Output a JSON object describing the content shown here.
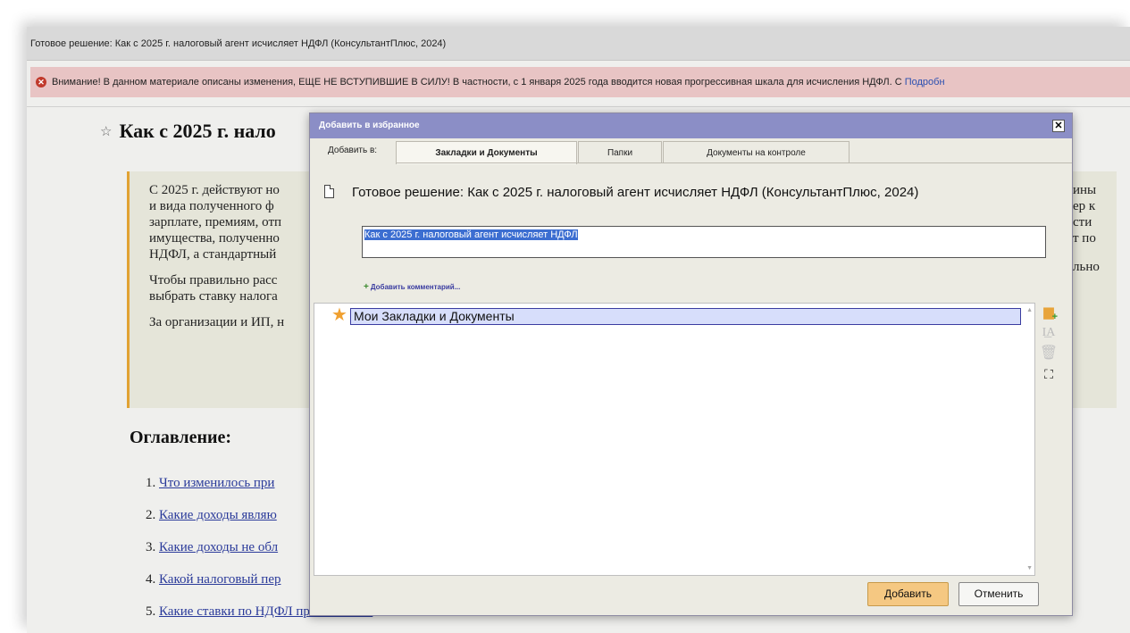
{
  "document": {
    "window_title": "Готовое решение: Как с 2025 г. налоговый агент исчисляет НДФЛ (КонсультантПлюс, 2024)",
    "warning_text": "Внимание! В данном материале описаны изменения, ЕЩЕ НЕ ВСТУПИВШИЕ В СИЛУ! В частности, с 1 января 2025 года вводится новая прогрессивная шкала для исчисления НДФЛ. С",
    "warning_more": "Подробн",
    "heading": "Как с 2025 г. нало",
    "infobox": {
      "left_lines": [
        "С 2025 г. действуют но",
        "и вида полученного ф",
        "зарплате, премиям, отп",
        "имущества, полученно",
        "НДФЛ, а стандартный"
      ],
      "left_para2": [
        "Чтобы правильно расс",
        "выбрать ставку налога"
      ],
      "left_para3": "За организации и ИП, н",
      "right_lines": [
        "ины",
        "ер к",
        "сти",
        "т по"
      ],
      "right_para2": "льно"
    },
    "toc_heading": "Оглавление:",
    "toc": [
      {
        "num": "1.",
        "text": "Что изменилось при"
      },
      {
        "num": "2.",
        "text": "Какие доходы являю"
      },
      {
        "num": "3.",
        "text": "Какие доходы не обл"
      },
      {
        "num": "4.",
        "text": "Какой налоговый пер"
      },
      {
        "num": "5.",
        "text": "Какие ставки по НДФЛ применяются"
      }
    ]
  },
  "dialog": {
    "title": "Добавить в избранное",
    "close_glyph": "✕",
    "add_to_label": "Добавить в:",
    "tabs": [
      "Закладки и Документы",
      "Папки",
      "Документы на контроле"
    ],
    "doc_line": "Готовое решение: Как с 2025 г. налоговый агент исчисляет НДФЛ (КонсультантПлюс, 2024)",
    "name_value": "Как с 2025 г. налоговый агент исчисляет НДФЛ",
    "add_comment": "Добавить комментарий...",
    "tree_item": "Мои Закладки и Документы",
    "buttons": {
      "add": "Добавить",
      "cancel": "Отменить"
    },
    "colors": {
      "titlebar": "#8b8ec6",
      "accent_button": "#f5c882",
      "selection": "#3c6ed1"
    }
  }
}
